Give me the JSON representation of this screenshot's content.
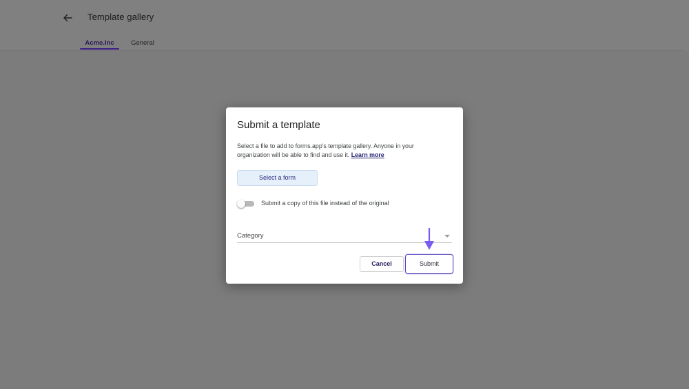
{
  "header": {
    "title": "Template gallery",
    "back_icon": "arrow-left-icon"
  },
  "tabs": [
    {
      "label": "Acme.Inc",
      "active": true
    },
    {
      "label": "General",
      "active": false
    }
  ],
  "dialog": {
    "title": "Submit a template",
    "description": "Select a file to add to forms.app's template gallery. Anyone in your organization will be able to find and use it.",
    "learn_more": "Learn more",
    "select_form_label": "Select a form",
    "toggle": {
      "label": "Submit a copy of this file instead of the original",
      "on": false
    },
    "category": {
      "label": "Category",
      "icon": "chevron-down-icon"
    },
    "cancel_label": "Cancel",
    "submit_label": "Submit"
  },
  "colors": {
    "overlay": "#7c7c7c",
    "accent": "#3c1f88",
    "arrow": "#7b5cf0",
    "select_button_bg": "#e6f0fb"
  }
}
